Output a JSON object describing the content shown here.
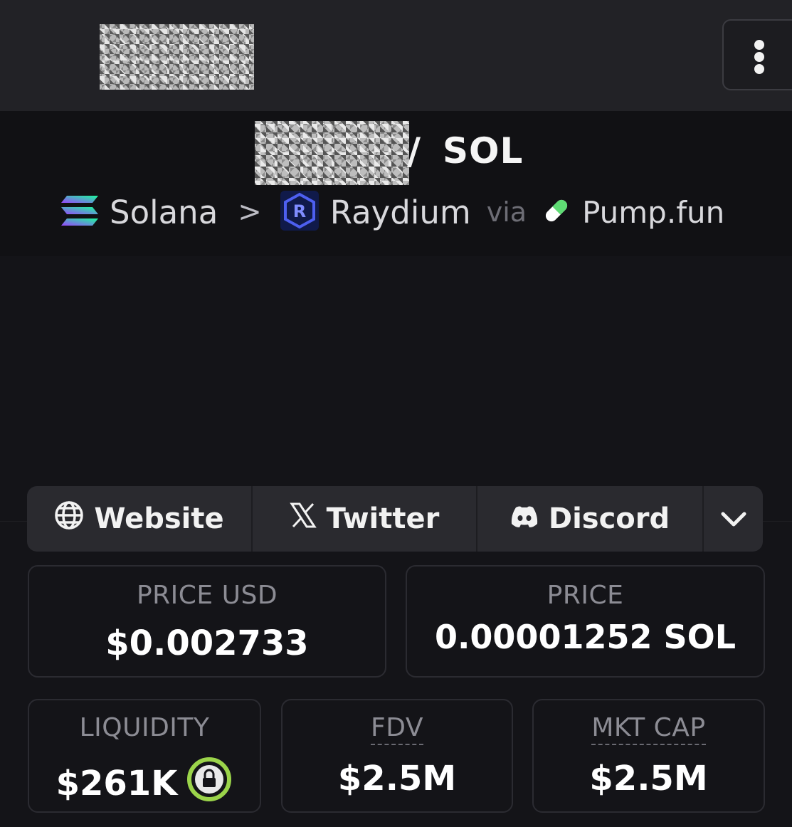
{
  "topbar": {
    "menu_icon": "vertical-dots-icon"
  },
  "pair": {
    "slash": "/",
    "quote_symbol": "SOL"
  },
  "breadcrumbs": {
    "chain": "Solana",
    "separator": ">",
    "dex": "Raydium",
    "via_label": "via",
    "launchpad": "Pump.fun",
    "icons": [
      "solana-icon",
      "chevron-right-icon",
      "raydium-icon",
      "pill-icon"
    ]
  },
  "links": {
    "website": "Website",
    "twitter": "Twitter",
    "discord": "Discord",
    "icons": [
      "globe-icon",
      "x-icon",
      "discord-icon",
      "chevron-down-icon"
    ]
  },
  "stats": {
    "price_usd_label": "PRICE USD",
    "price_usd_value": "$0.002733",
    "price_label": "PRICE",
    "price_value": "0.00001252 SOL",
    "liquidity_label": "LIQUIDITY",
    "liquidity_value": "$261K",
    "fdv_label": "FDV",
    "fdv_value": "$2.5M",
    "mktcap_label": "MKT CAP",
    "mktcap_value": "$2.5M"
  },
  "colors": {
    "background": "#141418",
    "topbar": "#222226",
    "lock_ring": "#9bd44a",
    "raydium_blue": "#3b4bd8",
    "pump_green": "#5fdc74"
  }
}
